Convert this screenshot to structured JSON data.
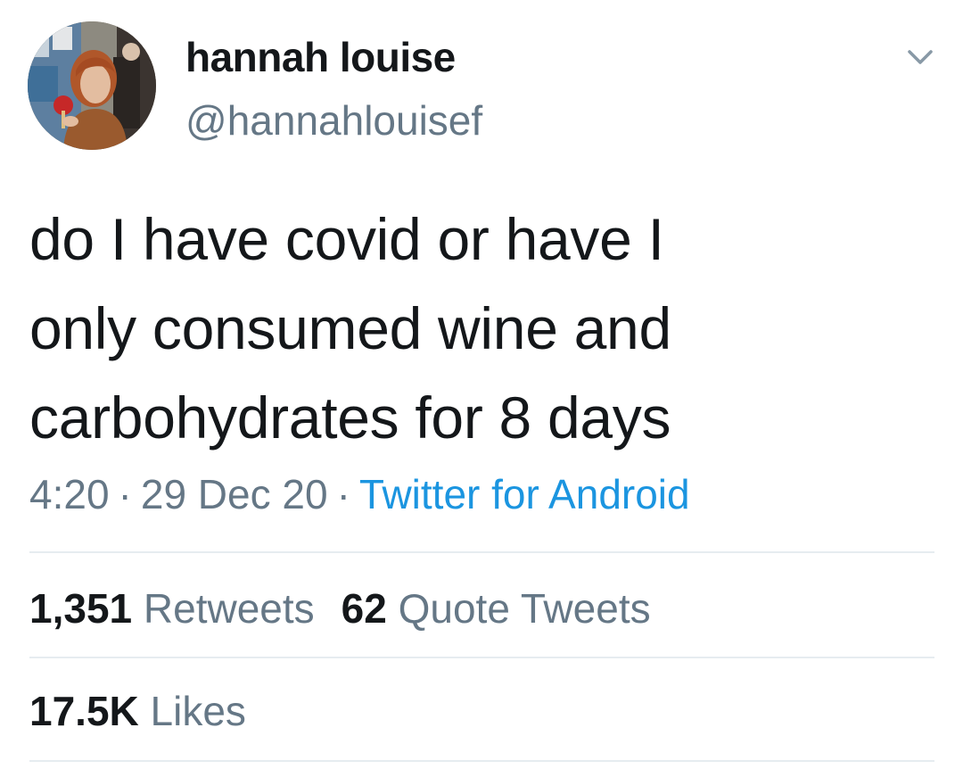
{
  "author": {
    "name": "hannah louise",
    "handle": "@hannahlouisef"
  },
  "tweet": {
    "text": "do I have covid or have I\nonly consumed wine and\ncarbohydrates for 8 days"
  },
  "meta": {
    "time": "4:20",
    "separator": "·",
    "date": "29 Dec 20",
    "source": "Twitter for Android"
  },
  "stats": {
    "retweets_count": "1,351",
    "retweets_label": "Retweets",
    "quotes_count": "62",
    "quotes_label": "Quote Tweets",
    "likes_count": "17.5K",
    "likes_label": "Likes"
  },
  "icons": {
    "menu": "chevron-down-icon"
  },
  "colors": {
    "primary_text": "#14171a",
    "secondary_text": "#657786",
    "link": "#1b95e0",
    "divider": "#e6ecf0"
  }
}
